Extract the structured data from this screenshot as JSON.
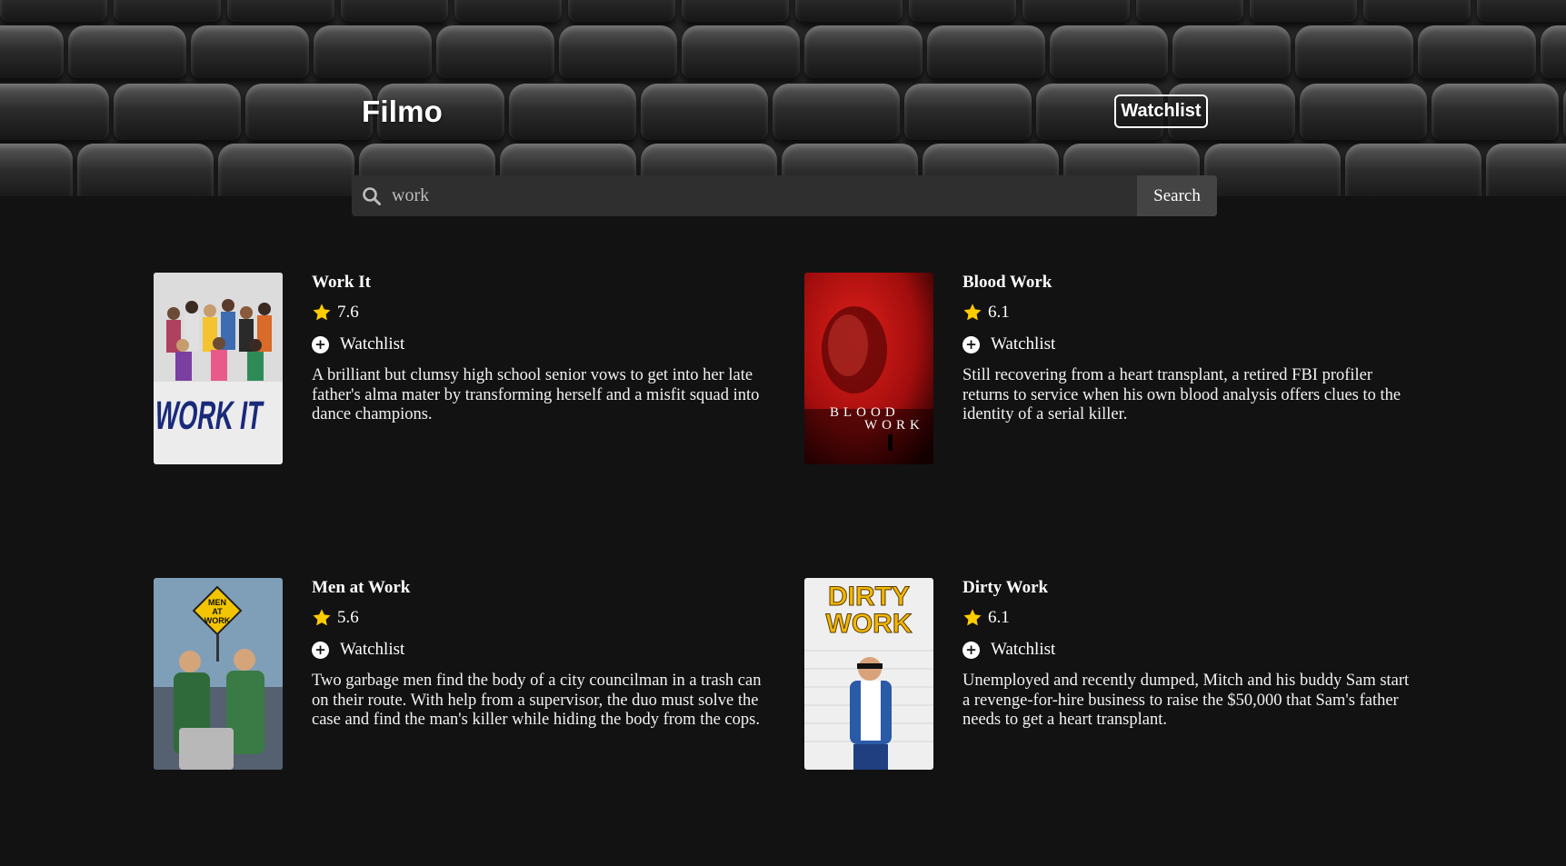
{
  "app": {
    "logo": "Filmo",
    "nav_watchlist_label": "Watchlist"
  },
  "search": {
    "value": "work",
    "button_label": "Search"
  },
  "colors": {
    "background": "#121212",
    "star": "#ffcc00",
    "search_bg": "#2f2f2f"
  },
  "results": [
    {
      "title": "Work It",
      "rating": "7.6",
      "watchlist_label": "Watchlist",
      "description": "A brilliant but clumsy high school senior vows to get into her late father's alma mater by transforming herself and a misfit squad into dance champions.",
      "poster_text": "WORK IT"
    },
    {
      "title": "Blood Work",
      "rating": "6.1",
      "watchlist_label": "Watchlist",
      "description": "Still recovering from a heart transplant, a retired FBI profiler returns to service when his own blood analysis offers clues to the identity of a serial killer.",
      "poster_text_line1": "BLOOD",
      "poster_text_line2": "WORK"
    },
    {
      "title": "Men at Work",
      "rating": "5.6",
      "watchlist_label": "Watchlist",
      "description": "Two garbage men find the body of a city councilman in a trash can on their route. With help from a supervisor, the duo must solve the case and find the man's killer while hiding the body from the cops.",
      "poster_sign_line1": "MEN",
      "poster_sign_line2": "AT",
      "poster_sign_line3": "WORK"
    },
    {
      "title": "Dirty Work",
      "rating": "6.1",
      "watchlist_label": "Watchlist",
      "description": "Unemployed and recently dumped, Mitch and his buddy Sam start a revenge-for-hire business to raise the $50,000 that Sam's father needs to get a heart transplant.",
      "poster_text_line1": "DIRTY",
      "poster_text_line2": "WORK"
    }
  ]
}
